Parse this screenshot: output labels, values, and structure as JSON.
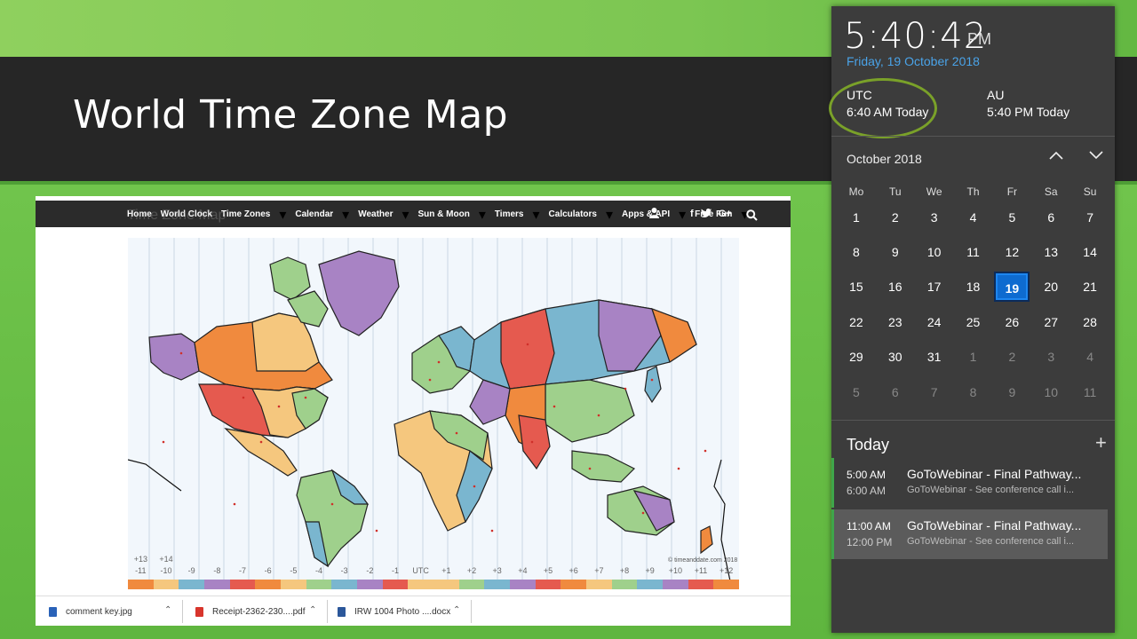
{
  "slide": {
    "title": "World Time Zone Map"
  },
  "nav": {
    "items": [
      "Home",
      "World Clock",
      "Time Zones",
      "Calendar",
      "Weather",
      "Sun & Moon",
      "Timers",
      "Calculators",
      "Apps & API",
      "Free Fun"
    ],
    "social": "f",
    "twitter": "🐦",
    "gplus": "G+"
  },
  "map": {
    "ghost_title": "Time Zone Map",
    "credit": "© timeanddate.com 2018",
    "tz_top": [
      "+13",
      "+14"
    ],
    "tz_labels": [
      "-11",
      "-10",
      "-9",
      "-8",
      "-7",
      "-6",
      "-5",
      "-4",
      "-3",
      "-2",
      "-1",
      "UTC",
      "+1",
      "+2",
      "+3",
      "+4",
      "+5",
      "+6",
      "+7",
      "+8",
      "+9",
      "+10",
      "+11",
      "+12"
    ],
    "tz_colors": [
      "#f08a3e",
      "#f5c77e",
      "#7ab6cf",
      "#a883c4",
      "#e55a4f",
      "#f08a3e",
      "#f5c77e",
      "#9fd08c",
      "#7ab6cf",
      "#a883c4",
      "#e55a4f",
      "#f5c77e",
      "#f5c77e",
      "#9fd08c",
      "#7ab6cf",
      "#a883c4",
      "#e55a4f",
      "#f08a3e",
      "#f5c77e",
      "#9fd08c",
      "#7ab6cf",
      "#a883c4",
      "#e55a4f",
      "#f08a3e"
    ]
  },
  "downloads": [
    {
      "name": "comment key.jpg",
      "color": "#2a62b8"
    },
    {
      "name": "Receipt-2362-230....pdf",
      "color": "#d8352c"
    },
    {
      "name": "IRW 1004 Photo ....docx",
      "color": "#2b579a"
    }
  ],
  "flyout": {
    "time": "5:40:42",
    "ampm": "PM",
    "date": "Friday, 19 October 2018",
    "zones": [
      {
        "name": "UTC",
        "value": "6:40 AM Today"
      },
      {
        "name": "AU",
        "value": "5:40 PM Today"
      }
    ],
    "month": "October 2018",
    "weekdays": [
      "Mo",
      "Tu",
      "We",
      "Th",
      "Fr",
      "Sa",
      "Su"
    ],
    "weeks": [
      [
        "1",
        "2",
        "3",
        "4",
        "5",
        "6",
        "7"
      ],
      [
        "8",
        "9",
        "10",
        "11",
        "12",
        "13",
        "14"
      ],
      [
        "15",
        "16",
        "17",
        "18",
        "19",
        "20",
        "21"
      ],
      [
        "22",
        "23",
        "24",
        "25",
        "26",
        "27",
        "28"
      ],
      [
        "29",
        "30",
        "31",
        "1",
        "2",
        "3",
        "4"
      ],
      [
        "5",
        "6",
        "7",
        "8",
        "9",
        "10",
        "11"
      ]
    ],
    "today": "19",
    "agenda_title": "Today",
    "events": [
      {
        "start": "5:00 AM",
        "end": "6:00 AM",
        "title": "GoToWebinar - Final Pathway...",
        "subtitle": "GoToWebinar - See conference call i..."
      },
      {
        "start": "11:00 AM",
        "end": "12:00 PM",
        "title": "GoToWebinar - Final Pathway...",
        "subtitle": "GoToWebinar - See conference call i..."
      }
    ]
  }
}
